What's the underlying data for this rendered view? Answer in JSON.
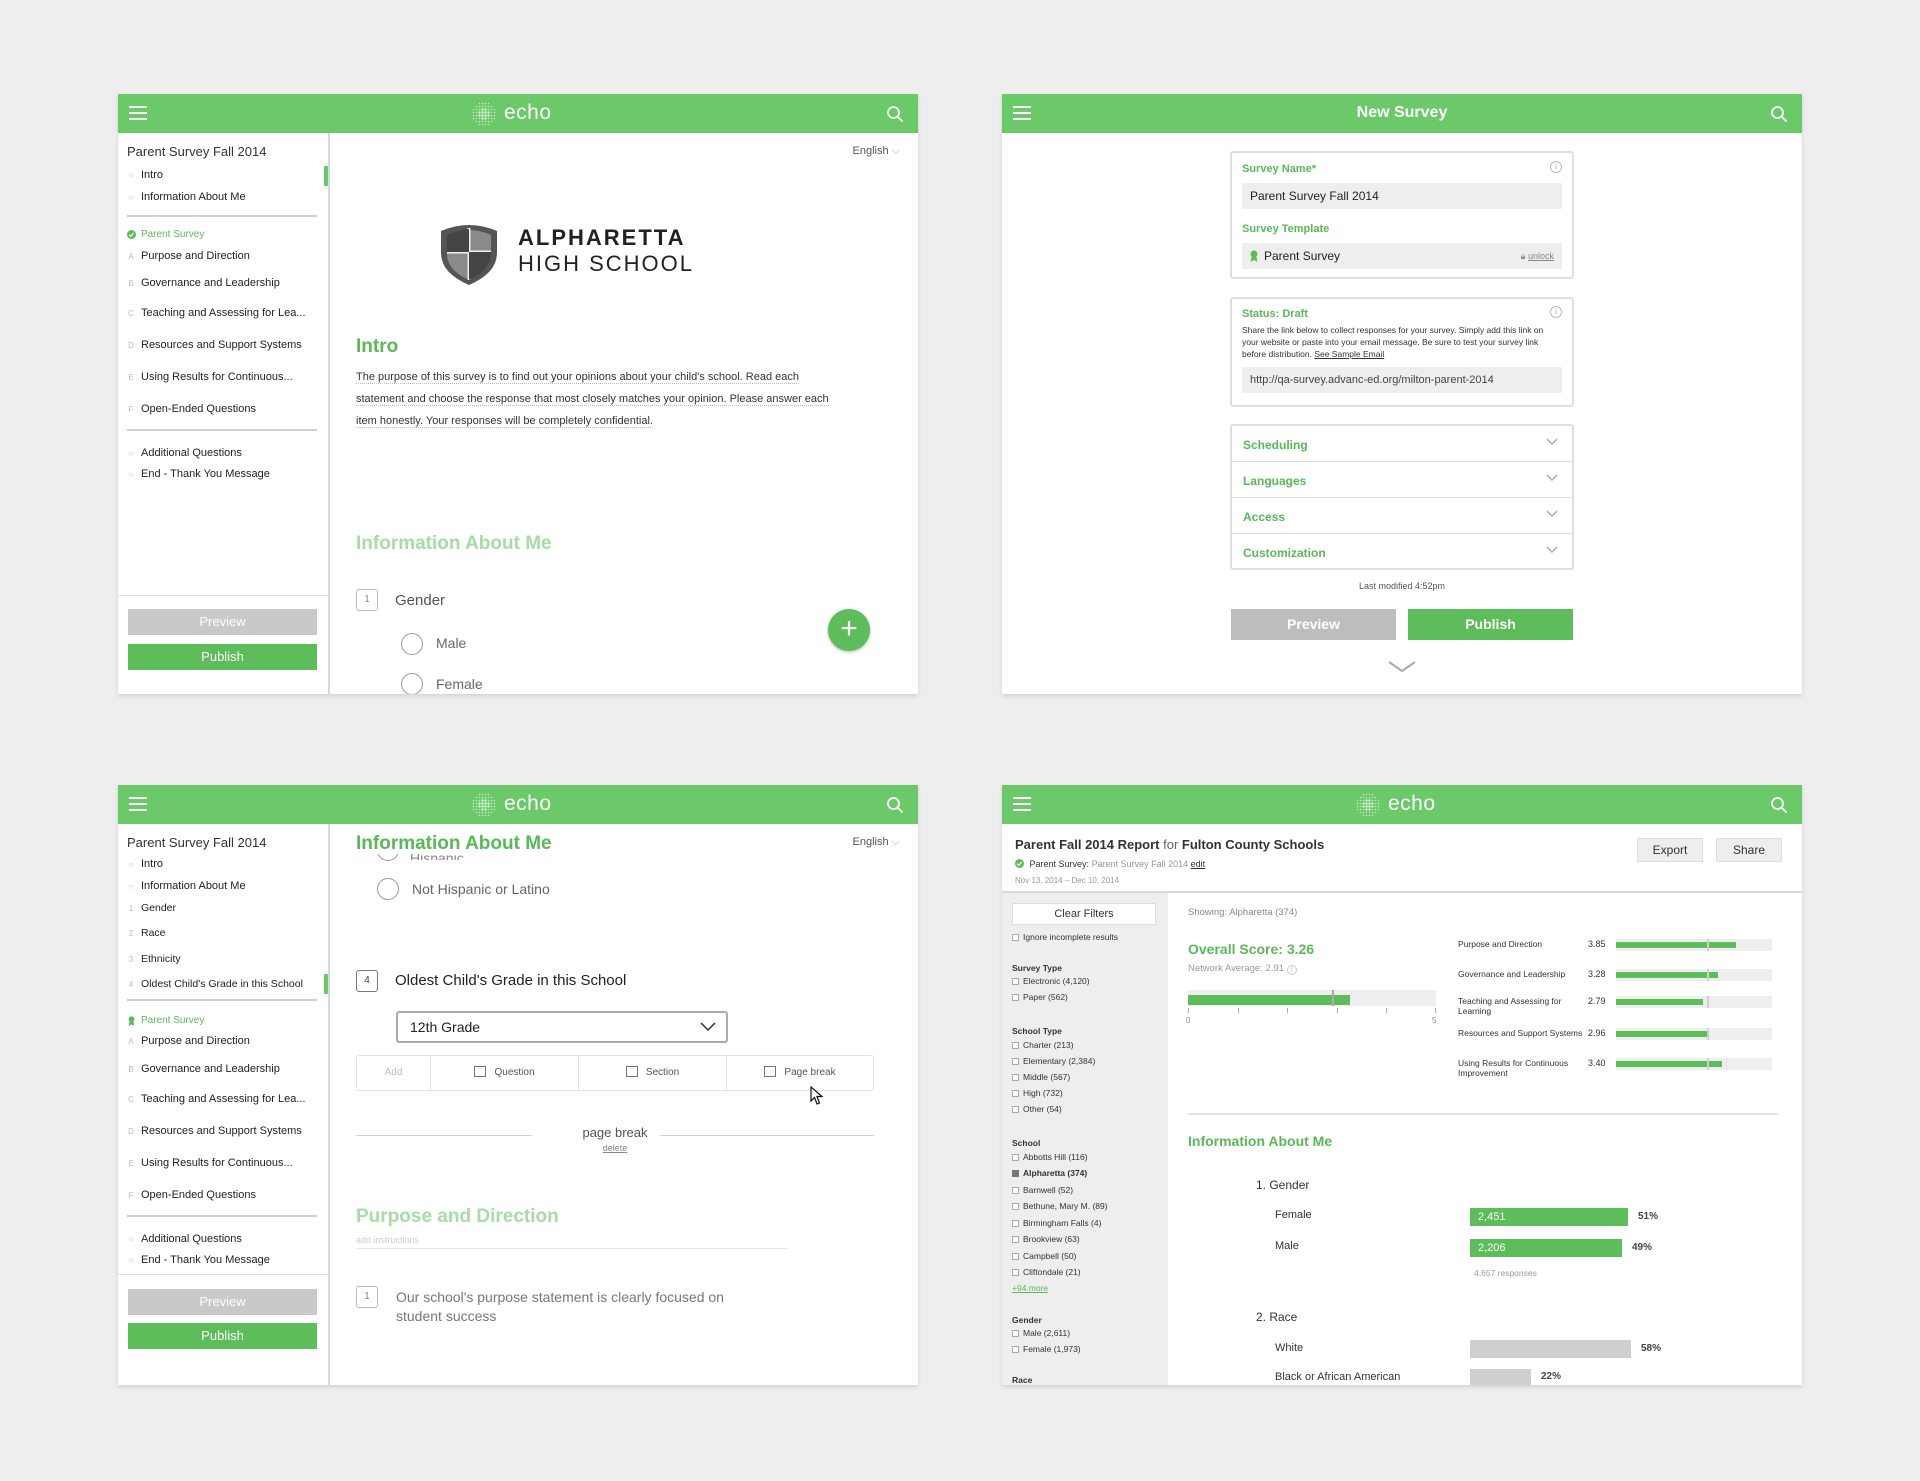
{
  "brand": {
    "app_name": "echo",
    "accent": "#6cc96a",
    "icons": [
      "hamburger-menu-icon",
      "search-icon",
      "echo-logo-icon"
    ]
  },
  "editor": {
    "survey_title": "Parent Survey Fall 2014",
    "language": "English",
    "sidebar1": {
      "items_top": [
        {
          "marker": "○",
          "label": "Intro"
        },
        {
          "marker": "○",
          "label": "Information About Me"
        }
      ],
      "template_label": "Parent Survey",
      "sections": [
        {
          "marker": "A",
          "label": "Purpose and Direction"
        },
        {
          "marker": "B",
          "label": "Governance and Leadership"
        },
        {
          "marker": "C",
          "label": "Teaching and Assessing for Lea..."
        },
        {
          "marker": "D",
          "label": "Resources and Support Systems"
        },
        {
          "marker": "E",
          "label": "Using Results for Continuous..."
        },
        {
          "marker": "F",
          "label": "Open-Ended Questions"
        }
      ],
      "items_bottom": [
        {
          "marker": "○",
          "label": "Additional Questions"
        },
        {
          "marker": "○",
          "label": "End - Thank You Message"
        }
      ]
    },
    "sidebar3": {
      "items_top": [
        {
          "marker": "○",
          "label": "Intro"
        },
        {
          "marker": "○",
          "label": "Information About Me"
        },
        {
          "marker": "1",
          "label": "Gender"
        },
        {
          "marker": "2",
          "label": "Race"
        },
        {
          "marker": "3",
          "label": "Ethnicity"
        },
        {
          "marker": "4",
          "label": "Oldest Child's Grade in this School"
        }
      ],
      "template_label": "Parent Survey",
      "sections": [
        {
          "marker": "A",
          "label": "Purpose and Direction"
        },
        {
          "marker": "B",
          "label": "Governance and Leadership"
        },
        {
          "marker": "C",
          "label": "Teaching and Assessing for Lea..."
        },
        {
          "marker": "D",
          "label": "Resources and Support Systems"
        },
        {
          "marker": "E",
          "label": "Using Results for Continuous..."
        },
        {
          "marker": "F",
          "label": "Open-Ended Questions"
        }
      ],
      "items_bottom": [
        {
          "marker": "○",
          "label": "Additional Questions"
        },
        {
          "marker": "○",
          "label": "End - Thank You Message"
        }
      ]
    },
    "preview_label": "Preview",
    "publish_label": "Publish",
    "school_name_line1": "ALPHARETTA",
    "school_name_line2": "HIGH SCHOOL",
    "intro_heading": "Intro",
    "intro_lines": [
      "The purpose of this survey is to find out your opinions about your child's school. Read each",
      "statement and choose the response that most closely matches your opinion.  Please answer each",
      "item honestly.  Your responses will be completely confidential."
    ],
    "info_heading": "Information About Me",
    "q1_number": "1",
    "q1_text": "Gender",
    "q1_options": [
      "Male",
      "Female"
    ],
    "fab_label": "+"
  },
  "editor2": {
    "heading": "Information About Me",
    "partial_option": "Hispanic",
    "option_not_hispanic": "Not Hispanic or Latino",
    "q4_number": "4",
    "q4_text": "Oldest Child's Grade in this School",
    "q4_value": "12th Grade",
    "add_bar": {
      "add": "Add",
      "question": "Question",
      "section": "Section",
      "page_break": "Page break"
    },
    "page_break_label": "page break",
    "delete_label": "delete",
    "section_heading": "Purpose and Direction",
    "add_instructions": "add instructions",
    "qa1_number": "1",
    "qa1_text_line1": "Our school's purpose statement is clearly focused on",
    "qa1_text_line2": "student success"
  },
  "new_survey": {
    "title": "New Survey",
    "name_label": "Survey Name*",
    "name_value": "Parent Survey Fall 2014",
    "template_label": "Survey Template",
    "template_value": "Parent Survey",
    "unlock_label": "unlock",
    "status_label": "Status: Draft",
    "status_help_line1": "Share the link below to collect responses for your survey. Simply add this link on",
    "status_help_line2": "your website or paste into your email message.  Be sure to test your survey link",
    "status_help_line3": "before distribution.",
    "see_sample": "See Sample Email",
    "url_value": "http://qa-survey.advanc-ed.org/milton-parent-2014",
    "accordion": [
      "Scheduling",
      "Languages",
      "Access",
      "Customization"
    ],
    "last_modified": "Last modified 4:52pm",
    "preview_label": "Preview",
    "publish_label": "Publish"
  },
  "report": {
    "title": "Parent Fall 2014 Report",
    "for_word": "for",
    "org": "Fulton County Schools",
    "survey_prefix": "Parent Survey:",
    "survey_name": "Parent Survey Fall 2014",
    "edit_label": "edit",
    "dates": "Nov 13, 2014 – Dec 10, 2014",
    "export_label": "Export",
    "share_label": "Share",
    "clear_filters": "Clear Filters",
    "ignore_incomplete": "Ignore incomplete results",
    "survey_type_heading": "Survey Type",
    "survey_types": [
      "Electronic (4,120)",
      "Paper (562)"
    ],
    "school_type_heading": "School Type",
    "school_types": [
      "Charter (213)",
      "Elementary (2,384)",
      "Middle (567)",
      "High (732)",
      "Other (54)"
    ],
    "school_heading": "School",
    "schools": [
      "Abbotts Hill (116)",
      "Alpharetta (374)",
      "Barnwell (52)",
      "Bethune, Mary M. (89)",
      "Birmingham Falls (4)",
      "Brookview (63)",
      "Campbell (50)",
      "Cliftondale (21)"
    ],
    "schools_more": "+94 more",
    "gender_heading": "Gender",
    "genders": [
      "Male (2,611)",
      "Female (1,973)"
    ],
    "race_heading": "Race",
    "showing": "Showing: Alpharetta (374)",
    "overall_label": "Overall Score: 3.26",
    "overall_score": 3.26,
    "network_avg_label": "Network Average: 2.91",
    "network_avg": 2.91,
    "gauge_min": "0",
    "gauge_max": "5",
    "domains": [
      {
        "name": "Purpose and Direction",
        "value": 3.85
      },
      {
        "name": "Governance and Leadership",
        "value": 3.28
      },
      {
        "name": "Teaching and Assessing for Learning",
        "value": 2.79
      },
      {
        "name": "Resources and Support Systems",
        "value": 2.96
      },
      {
        "name": "Using Results for Continuous Improvement",
        "value": 3.4
      }
    ],
    "section_heading": "Information About Me",
    "gender_q": "1. Gender",
    "gender_rows": [
      {
        "label": "Female",
        "count": "2,451",
        "pct": "51%",
        "frac": 0.51
      },
      {
        "label": "Male",
        "count": "2,206",
        "pct": "49%",
        "frac": 0.49
      }
    ],
    "responses": "4,657 responses",
    "race_q": "2. Race",
    "race_rows": [
      {
        "label": "White",
        "pct": "58%",
        "frac": 0.58
      },
      {
        "label": "Black or African American",
        "pct": "22%",
        "frac": 0.22
      }
    ]
  }
}
